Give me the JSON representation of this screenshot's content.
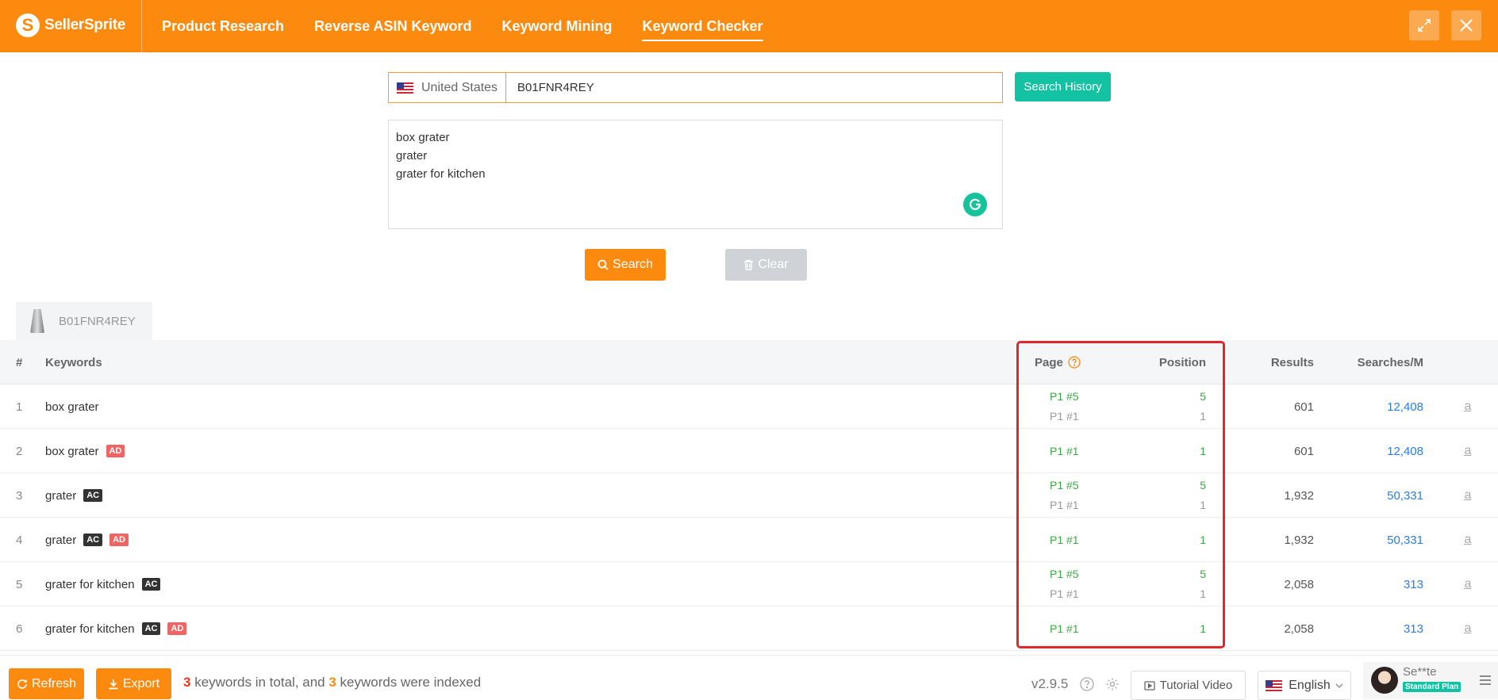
{
  "app": {
    "name": "SellerSprite"
  },
  "nav": {
    "items": [
      {
        "label": "Product Research"
      },
      {
        "label": "Reverse ASIN Keyword"
      },
      {
        "label": "Keyword Mining"
      },
      {
        "label": "Keyword Checker"
      }
    ],
    "active": "Keyword Checker"
  },
  "search": {
    "marketplace": "United States",
    "asin_value": "B01FNR4REY",
    "history_label": "Search History",
    "keywords_lines": [
      "box grater",
      "grater",
      "grater for kitchen"
    ],
    "search_label": "Search",
    "clear_label": "Clear"
  },
  "result_tab": {
    "asin": "B01FNR4REY"
  },
  "table": {
    "headers": {
      "index": "#",
      "keywords": "Keywords",
      "page": "Page",
      "position": "Position",
      "results": "Results",
      "searches": "Searches/M"
    },
    "rows": [
      {
        "index": "1",
        "keyword": "box grater",
        "tags": [],
        "page_primary": "P1 #5",
        "page_secondary": "P1 #1",
        "pos_primary": "5",
        "pos_secondary": "1",
        "results": "601",
        "searches": "12,408"
      },
      {
        "index": "2",
        "keyword": "box grater",
        "tags": [
          "AD"
        ],
        "page_primary": "P1 #1",
        "page_secondary": "",
        "pos_primary": "1",
        "pos_secondary": "",
        "results": "601",
        "searches": "12,408"
      },
      {
        "index": "3",
        "keyword": "grater",
        "tags": [
          "AC"
        ],
        "page_primary": "P1 #5",
        "page_secondary": "P1 #1",
        "pos_primary": "5",
        "pos_secondary": "1",
        "results": "1,932",
        "searches": "50,331"
      },
      {
        "index": "4",
        "keyword": "grater",
        "tags": [
          "AC",
          "AD"
        ],
        "page_primary": "P1 #1",
        "page_secondary": "",
        "pos_primary": "1",
        "pos_secondary": "",
        "results": "1,932",
        "searches": "50,331"
      },
      {
        "index": "5",
        "keyword": "grater for kitchen",
        "tags": [
          "AC"
        ],
        "page_primary": "P1 #5",
        "page_secondary": "P1 #1",
        "pos_primary": "5",
        "pos_secondary": "1",
        "results": "2,058",
        "searches": "313"
      },
      {
        "index": "6",
        "keyword": "grater for kitchen",
        "tags": [
          "AC",
          "AD"
        ],
        "page_primary": "P1 #1",
        "page_secondary": "",
        "pos_primary": "1",
        "pos_secondary": "",
        "results": "2,058",
        "searches": "313"
      }
    ]
  },
  "footer": {
    "refresh_label": "Refresh",
    "export_label": "Export",
    "total_count": "3",
    "summary_mid": " keywords in total, and ",
    "indexed_count": "3",
    "summary_end": " keywords were indexed",
    "version": "v2.9.5",
    "tutorial_label": "Tutorial Video",
    "language": "English",
    "user_name": "Se**te",
    "plan": "Standard Plan"
  },
  "colors": {
    "brand_orange": "#fb8a0f",
    "teal": "#12c2a3",
    "rank_green": "#3aa845",
    "link_blue": "#2c7de0",
    "highlight_red": "#e0282b"
  }
}
